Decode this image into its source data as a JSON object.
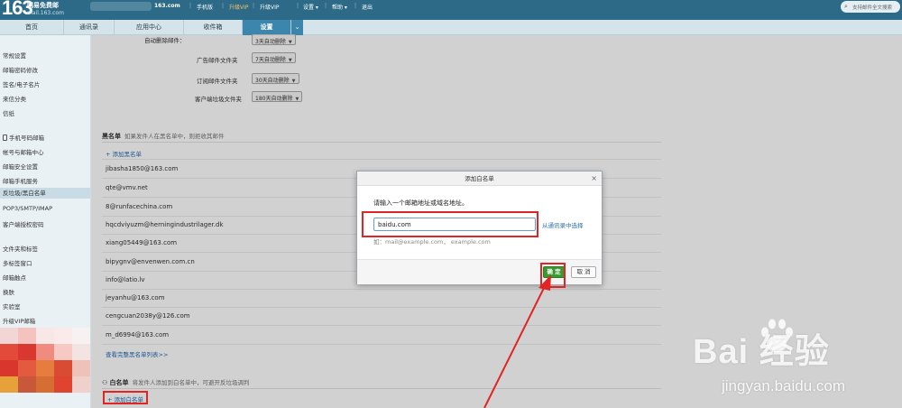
{
  "topbar": {
    "logo_number": "163",
    "logo_text": "网易免费邮",
    "logo_domain": "mail.163.com",
    "account_suffix": "163.com",
    "links": [
      "手机版",
      "升级VIP",
      "设置 ▾",
      "帮助 ▾",
      "退出"
    ],
    "search_placeholder": "支持邮件全文搜索"
  },
  "nav": {
    "tabs": [
      "首页",
      "通讯录",
      "应用中心",
      "收件箱",
      "设置"
    ],
    "active_tab": "设置"
  },
  "sidebar": {
    "group1": [
      "常规设置",
      "邮箱密码修改",
      "签名/电子名片",
      "来信分类",
      "信纸"
    ],
    "group2": [
      "手机号码邮箱",
      "帐号与邮箱中心",
      "邮箱安全设置",
      "邮箱手机服务",
      "反垃圾/黑白名单",
      "POP3/SMTP/IMAP",
      "客户端授权密码"
    ],
    "group3": [
      "文件夹和标签",
      "多标签窗口",
      "邮箱触点",
      "换肤",
      "实验室",
      "升级VIP邮箱"
    ],
    "active_item": "反垃圾/黑白名单"
  },
  "settings_rows": [
    {
      "label": "自动删除邮件：",
      "value": "3天自动删除"
    },
    {
      "label": "广告邮件文件夹",
      "value": "7天自动删除"
    },
    {
      "label": "订阅邮件文件夹",
      "value": "30天自动删除"
    },
    {
      "label": "客户端垃圾文件夹",
      "value": "180天自动删除"
    }
  ],
  "blacklist": {
    "title": "黑名单",
    "description": "如果发件人在黑名单中，则拒收其邮件",
    "add_label": "+ 添加黑名单",
    "entries": [
      "jibasha1850@163.com",
      "qte@vmv.net",
      "8@runfacechina.com",
      "hqcdviyuzm@herningindustrilager.dk",
      "xiang05449@163.com",
      "bipygnv@envenwen.com.cn",
      "info@latio.lv",
      "jeyanhu@163.com",
      "cengcuan2038y@126.com",
      "m_d6994@163.com"
    ],
    "more_label": "查看完整黑名单列表>>"
  },
  "whitelist": {
    "title": "白名单",
    "description": "将发件人添加到白名单中，可避开反垃圾调判",
    "add_label": "+ 添加白名单"
  },
  "dialog": {
    "title": "添加白名单",
    "close": "×",
    "prompt": "请输入一个邮箱地址或域名地址。",
    "input_value": "baidu.com",
    "contact_link": "从通讯录中选择",
    "hint": "如：mail@example.com， example.com",
    "ok_label": "确 定",
    "cancel_label": "取 消"
  },
  "watermark": {
    "logo": "Bai  经验",
    "url": "jingyan.baidu.com"
  },
  "colors": {
    "topbar": "#2c6a87",
    "active_tab": "#3c86ad",
    "ok_button": "#3a9a2f",
    "highlight": "#e02525",
    "link": "#2a6db0"
  }
}
